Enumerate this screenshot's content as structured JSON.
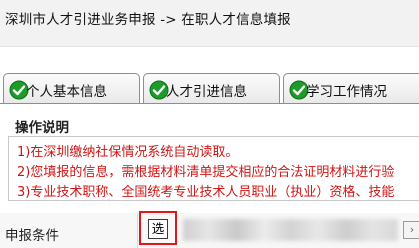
{
  "breadcrumb": {
    "title": "深圳市人才引进业务申报 -> 在职人才信息填报"
  },
  "tabs": [
    {
      "label": "个人基本信息",
      "icon": "check-circle-icon"
    },
    {
      "label": "人才引进信息",
      "icon": "check-circle-icon"
    },
    {
      "label": "学习工作情况",
      "icon": "check-circle-icon"
    }
  ],
  "instructions": {
    "title": "操作说明",
    "items": [
      "1)在深圳缴纳社保情况系统自动读取。",
      "2)您填报的信息，需根据材料清单提交相应的合法证明材料进行验",
      "3)专业技术职称、全国统考专业技术人员职业（执业）资格、技能"
    ]
  },
  "form": {
    "label": "申报条件",
    "select_button": "选"
  },
  "colors": {
    "note_text": "#d21414",
    "highlight": "#e01818",
    "check_green": "#1e9c2a"
  }
}
